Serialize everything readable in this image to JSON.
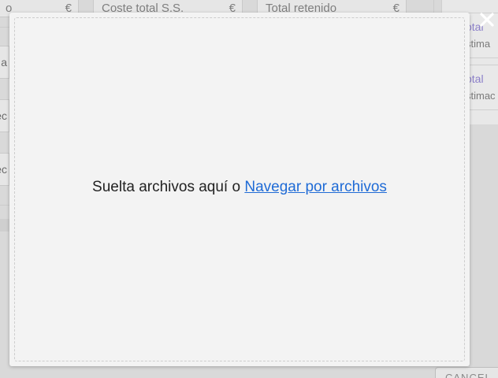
{
  "background": {
    "fields": [
      {
        "label": "o",
        "unit": "€"
      },
      {
        "label": "Coste total S.S.",
        "unit": "€"
      },
      {
        "label": "Total retenido",
        "unit": "€"
      }
    ],
    "left_rows": [
      "a",
      "ec",
      "ec"
    ],
    "right_cards": [
      {
        "label": "otal",
        "sub": "stima"
      },
      {
        "label": "otal",
        "sub": "stimac"
      }
    ],
    "cancel_label": "CANCEL"
  },
  "modal": {
    "drop_text": "Suelta archivos aquí o ",
    "browse_link": "Navegar por archivos",
    "close_icon": "✕"
  },
  "colors": {
    "link": "#1f6bd6",
    "modal_bg": "#f3f3f3"
  }
}
